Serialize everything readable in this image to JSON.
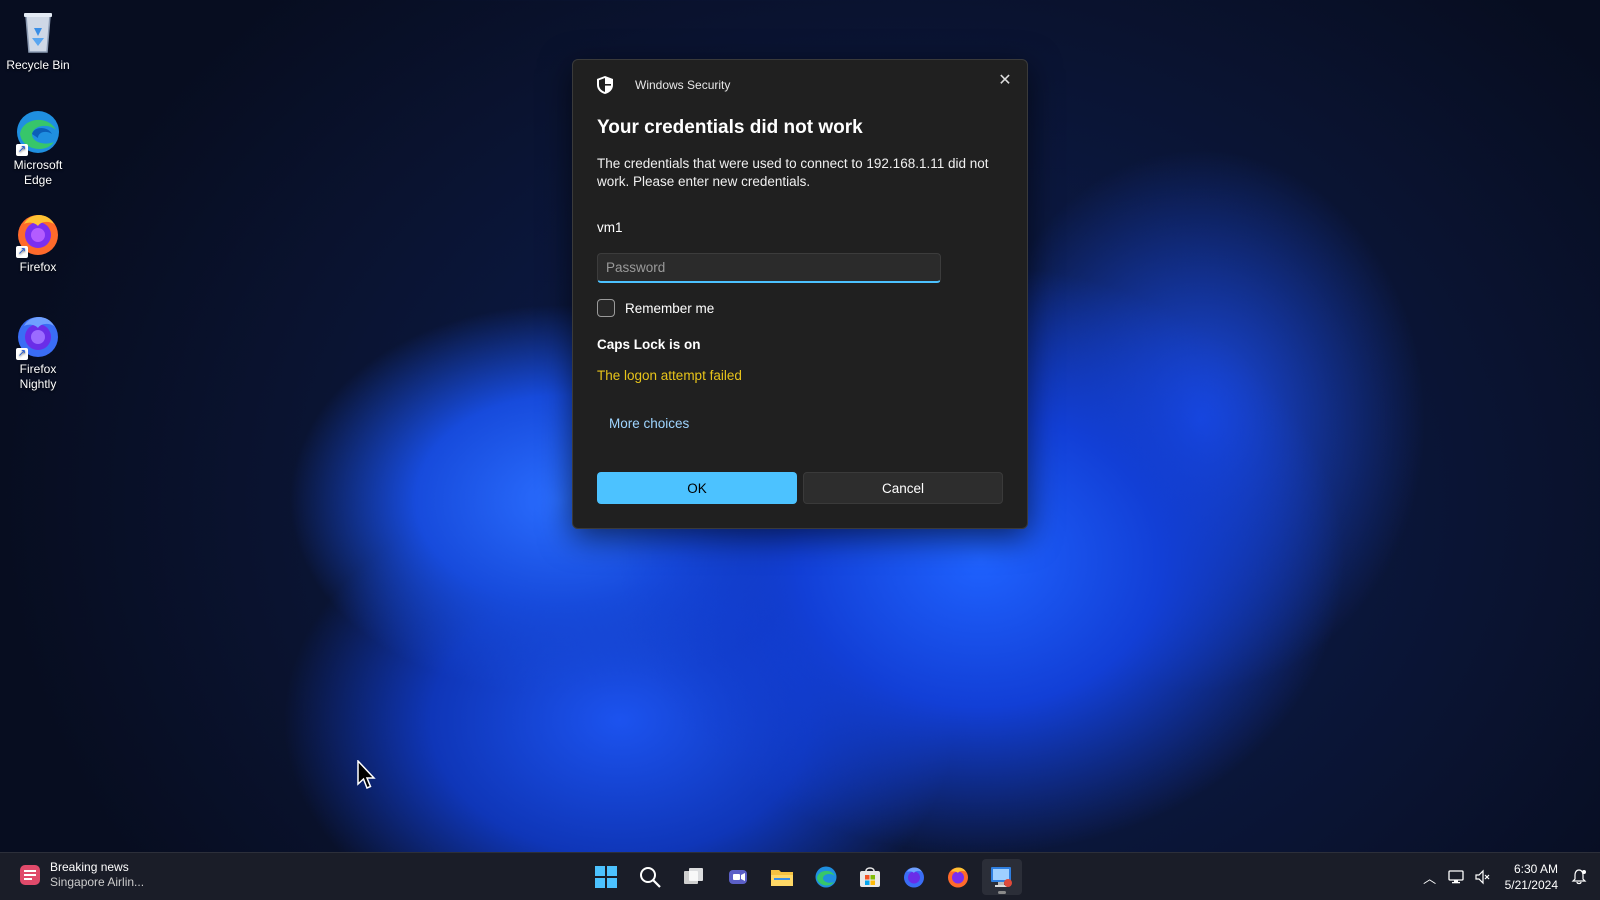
{
  "desktop": {
    "icons": [
      {
        "label": "Recycle Bin"
      },
      {
        "label": "Microsoft Edge"
      },
      {
        "label": "Firefox"
      },
      {
        "label": "Firefox Nightly"
      }
    ]
  },
  "dialog": {
    "app_title": "Windows Security",
    "heading": "Your credentials did not work",
    "message": "The credentials that were used to connect to 192.168.1.11 did not work. Please enter new credentials.",
    "username": "vm1",
    "password_placeholder": "Password",
    "password_value": "",
    "remember_label": "Remember me",
    "remember_checked": false,
    "caps_lock_text": "Caps Lock is on",
    "error_text": "The logon attempt failed",
    "more_choices": "More choices",
    "ok_label": "OK",
    "cancel_label": "Cancel",
    "accent_color": "#4cc2ff",
    "error_color": "#e8c41a"
  },
  "taskbar": {
    "news_title": "Breaking news",
    "news_sub": "Singapore Airlin...",
    "pinned": [
      "start-icon",
      "search-icon",
      "task-view-icon",
      "teams-icon",
      "file-explorer-icon",
      "edge-icon",
      "store-icon",
      "firefox-nightly-icon",
      "firefox-icon",
      "remote-desktop-icon"
    ],
    "clock_time": "6:30 AM",
    "clock_date": "5/21/2024"
  }
}
